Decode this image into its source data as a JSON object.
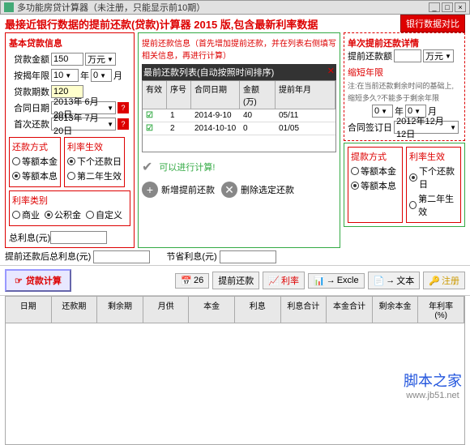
{
  "titlebar": {
    "text": "多功能房贷计算器（未注册，只能显示前10期）"
  },
  "banner": {
    "text": "最接近银行数据的提前还款(贷款)计算器 2015 版,包含最新利率数据",
    "btn": "银行数据对比"
  },
  "left": {
    "title": "基本贷款信息",
    "loan_amt_label": "贷款金额",
    "loan_amt": "150",
    "loan_unit": "万元",
    "years_label": "按揭年限",
    "years": "10",
    "period": "0",
    "period_unit": "月",
    "periods_label": "贷款期数",
    "periods": "120",
    "contract_label": "合同日期",
    "contract": "2013年 6月20日",
    "first_label": "首次还款",
    "first": "2013年 7月20日",
    "repay_title": "还款方式",
    "rate_title": "利率生效",
    "r1": "等额本金",
    "r2": "等额本息",
    "r3": "下个还款日",
    "r4": "第二年生效",
    "rate_cat_title": "利率类别",
    "rc1": "商业",
    "rc2": "公积金",
    "rc3": "自定义",
    "total_label": "总利息(元)"
  },
  "mid": {
    "hint": "提前还款信息（首先增加提前还款，并在列表右侧填写相关信息，再进行计算）",
    "list_title": "最前还款列表(自动按照时间排序)",
    "cols": {
      "valid": "有效",
      "seq": "序号",
      "date": "合同日期",
      "amt": "金额(万)",
      "ym": "提前年月"
    },
    "rows": [
      {
        "valid": "☑",
        "seq": "1",
        "date": "2014-9-10",
        "amt": "40",
        "ym": "05/11"
      },
      {
        "valid": "☑",
        "seq": "2",
        "date": "2014-10-10",
        "amt": "0",
        "ym": "01/05"
      }
    ],
    "calc_ok": "可以进行计算!",
    "add_btn": "新增提前还款",
    "del_btn": "删除选定还款",
    "after_label": "提前还款后总利息(元)",
    "save_label": "节省利息(元)"
  },
  "rt": {
    "title": "单次提前还款详情",
    "amt_label": "提前还款额",
    "amt_unit": "万元",
    "short_label": "缩短年限",
    "hint1": "注:在当前还款剩余时间的基础上,",
    "hint2": "缩短多久?不能多于剩余年限",
    "y": "0",
    "y_unit": "年",
    "m": "0",
    "m_unit": "月",
    "contract_label": "合同签订日",
    "contract": "2012年12月12日",
    "repay_title": "提款方式",
    "rate_title": "利率生效",
    "r1": "等额本金",
    "r2": "等额本息",
    "r3": "下个还款日",
    "r4": "第二年生效"
  },
  "toolbar": {
    "calc": "贷款计算",
    "num": "26",
    "pre": "提前还款",
    "rate": "利率",
    "excel": "Excle",
    "txt": "文本",
    "reg": "注册"
  },
  "grid": {
    "c1": "日期",
    "c2": "还款期",
    "c3": "剩余期",
    "c4": "月供",
    "c5": "本金",
    "c6": "利息",
    "c7": "利息合计",
    "c8": "本金合计",
    "c9": "剩余本金",
    "c10": "年利率(%)"
  },
  "watermark": {
    "t1": "脚本之家",
    "t2": "www.jb51.net"
  }
}
